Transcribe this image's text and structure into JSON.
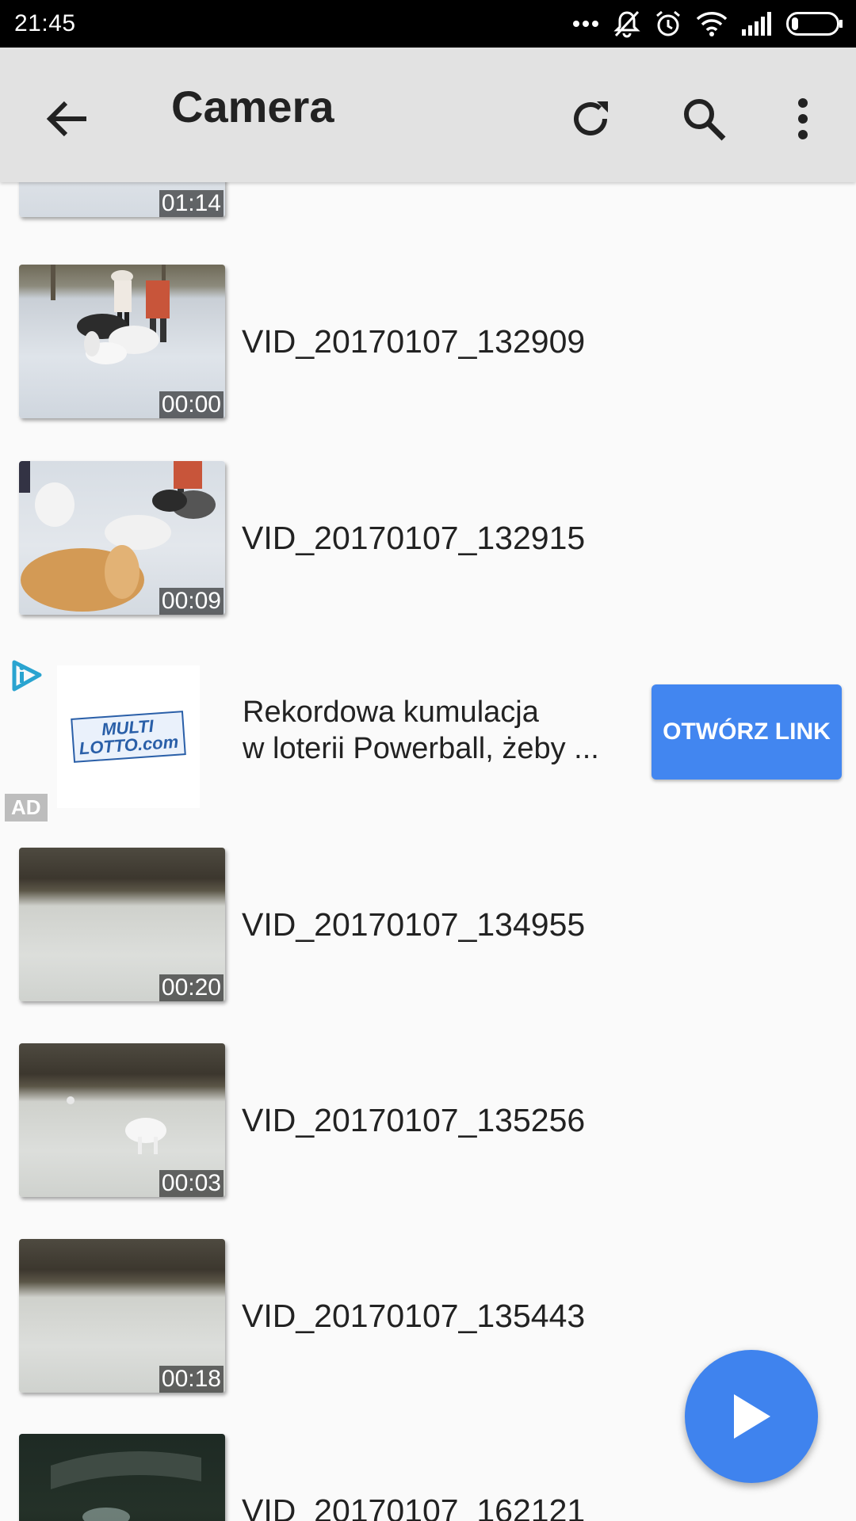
{
  "status_bar": {
    "time": "21:45",
    "icons": [
      "more-dots-icon",
      "bell-muted-icon",
      "alarm-icon",
      "wifi-icon",
      "signal-icon",
      "battery-icon"
    ]
  },
  "toolbar": {
    "title": "Camera",
    "back_icon": "arrow-left-icon",
    "actions": [
      "refresh-icon",
      "search-icon",
      "more-vert-icon"
    ]
  },
  "videos": [
    {
      "title": "",
      "duration": "01:14"
    },
    {
      "title": "VID_20170107_132909",
      "duration": "00:00"
    },
    {
      "title": "VID_20170107_132915",
      "duration": "00:09"
    },
    {
      "title": "VID_20170107_134955",
      "duration": "00:20"
    },
    {
      "title": "VID_20170107_135256",
      "duration": "00:03"
    },
    {
      "title": "VID_20170107_135443",
      "duration": "00:18"
    },
    {
      "title": "VID_20170107_162121",
      "duration": ""
    }
  ],
  "ad": {
    "line1": "Rekordowa kumulacja",
    "line2": "w loterii Powerball, żeby ...",
    "button_label": "OTWÓRZ LINK",
    "badge": "AD",
    "logo_line1": "MULTI",
    "logo_line2": "LOTTO.com"
  },
  "colors": {
    "accent": "#4286f0",
    "toolbar_bg": "#e2e2e2",
    "page_bg": "#fafafa"
  }
}
